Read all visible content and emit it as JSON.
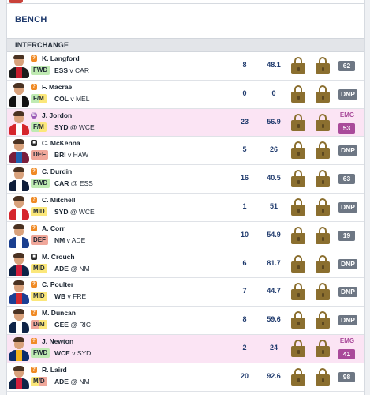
{
  "bench": {
    "title": "BENCH"
  },
  "section": {
    "title": "INTERCHANGE"
  },
  "colors": {
    "locked": "#8b6f2f",
    "emergency": "#a94a9a",
    "score_badge": "#6e7784"
  },
  "players": [
    {
      "name": "K. Langford",
      "status_icon": "question-icon",
      "status_glyph": "?",
      "position": "FWD",
      "pos_class": "FWD",
      "team": "ESS",
      "sep": "v",
      "opponent": "CAR",
      "stat1": "8",
      "stat2": "48.1",
      "emg_label": "",
      "score": "62",
      "guernsey": [
        "#1d1d1d",
        "#c81e2d"
      ],
      "emergency": false
    },
    {
      "name": "F. Macrae",
      "status_icon": "question-icon",
      "status_glyph": "?",
      "position": "F/M",
      "pos_class": "FM",
      "team": "COL",
      "sep": "v",
      "opponent": "MEL",
      "stat1": "0",
      "stat2": "0",
      "emg_label": "",
      "score": "DNP",
      "guernsey": [
        "#111111",
        "#f2f2f2"
      ],
      "emergency": false
    },
    {
      "name": "J. Jordon",
      "status_icon": "emergency-icon",
      "status_glyph": "E",
      "position": "F/M",
      "pos_class": "FM",
      "team": "SYD",
      "sep": "@",
      "opponent": "WCE",
      "stat1": "23",
      "stat2": "56.9",
      "emg_label": "EMG",
      "score": "53",
      "guernsey": [
        "#d5252c",
        "#ffffff"
      ],
      "emergency": true
    },
    {
      "name": "C. McKenna",
      "status_icon": "camera-icon",
      "status_glyph": "■",
      "position": "DEF",
      "pos_class": "DEF",
      "team": "BRI",
      "sep": "v",
      "opponent": "HAW",
      "stat1": "5",
      "stat2": "26",
      "emg_label": "",
      "score": "DNP",
      "guernsey": [
        "#7a1e3c",
        "#1e63b3"
      ],
      "emergency": false
    },
    {
      "name": "C. Durdin",
      "status_icon": "question-icon",
      "status_glyph": "?",
      "position": "FWD",
      "pos_class": "FWD",
      "team": "CAR",
      "sep": "@",
      "opponent": "ESS",
      "stat1": "16",
      "stat2": "40.5",
      "emg_label": "",
      "score": "63",
      "guernsey": [
        "#0e1d3a",
        "#ffffff"
      ],
      "emergency": false
    },
    {
      "name": "C. Mitchell",
      "status_icon": "question-icon",
      "status_glyph": "?",
      "position": "MID",
      "pos_class": "MID",
      "team": "SYD",
      "sep": "@",
      "opponent": "WCE",
      "stat1": "1",
      "stat2": "51",
      "emg_label": "",
      "score": "DNP",
      "guernsey": [
        "#d5252c",
        "#ffffff"
      ],
      "emergency": false
    },
    {
      "name": "A. Corr",
      "status_icon": "question-icon",
      "status_glyph": "?",
      "position": "DEF",
      "pos_class": "DEF",
      "team": "NM",
      "sep": "v",
      "opponent": "ADE",
      "stat1": "10",
      "stat2": "54.9",
      "emg_label": "",
      "score": "19",
      "guernsey": [
        "#1a3f8f",
        "#ffffff"
      ],
      "emergency": false
    },
    {
      "name": "M. Crouch",
      "status_icon": "camera-icon",
      "status_glyph": "■",
      "position": "MID",
      "pos_class": "MID",
      "team": "ADE",
      "sep": "@",
      "opponent": "NM",
      "stat1": "6",
      "stat2": "81.7",
      "emg_label": "",
      "score": "DNP",
      "guernsey": [
        "#0f2447",
        "#d21f3c"
      ],
      "emergency": false
    },
    {
      "name": "C. Poulter",
      "status_icon": "question-icon",
      "status_glyph": "?",
      "position": "MID",
      "pos_class": "MID",
      "team": "WB",
      "sep": "v",
      "opponent": "FRE",
      "stat1": "7",
      "stat2": "44.7",
      "emg_label": "",
      "score": "DNP",
      "guernsey": [
        "#1c3f94",
        "#d52a30"
      ],
      "emergency": false
    },
    {
      "name": "M. Duncan",
      "status_icon": "question-icon",
      "status_glyph": "?",
      "position": "D/M",
      "pos_class": "DM",
      "team": "GEE",
      "sep": "@",
      "opponent": "RIC",
      "stat1": "8",
      "stat2": "59.6",
      "emg_label": "",
      "score": "DNP",
      "guernsey": [
        "#0f2447",
        "#ffffff"
      ],
      "emergency": false
    },
    {
      "name": "J. Newton",
      "status_icon": "question-icon",
      "status_glyph": "?",
      "position": "FWD",
      "pos_class": "FWD",
      "team": "WCE",
      "sep": "v",
      "opponent": "SYD",
      "stat1": "2",
      "stat2": "24",
      "emg_label": "EMG",
      "score": "41",
      "guernsey": [
        "#0b2d6b",
        "#f2b31b"
      ],
      "emergency": true
    },
    {
      "name": "R. Laird",
      "status_icon": "question-icon",
      "status_glyph": "?",
      "position": "M/D",
      "pos_class": "MD",
      "team": "ADE",
      "sep": "@",
      "opponent": "NM",
      "stat1": "20",
      "stat2": "92.6",
      "emg_label": "",
      "score": "98",
      "guernsey": [
        "#0f2447",
        "#d21f3c"
      ],
      "emergency": false
    }
  ]
}
